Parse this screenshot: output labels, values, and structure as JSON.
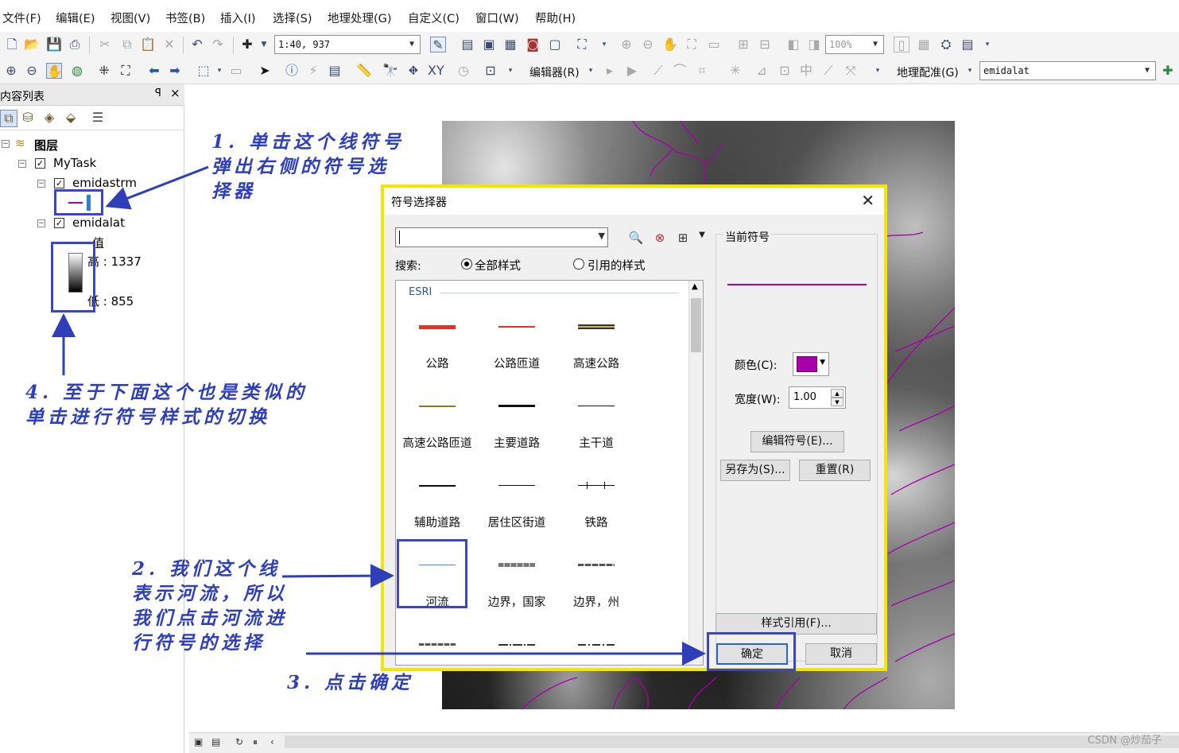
{
  "menu": [
    "文件(F)",
    "编辑(E)",
    "视图(V)",
    "书签(B)",
    "插入(I)",
    "选择(S)",
    "地理处理(G)",
    "自定义(C)",
    "窗口(W)",
    "帮助(H)"
  ],
  "toolbar": {
    "scale": "1:40, 937",
    "zoom_percent": "100%",
    "editor_label": "编辑器(R)",
    "georef_label": "地理配准(G)",
    "georef_layer": "emidalat"
  },
  "toc": {
    "title": "内容列表",
    "pin": "ᵖ",
    "close": "×",
    "root": "图层",
    "frame": "MyTask",
    "layer1": "emidastrm",
    "layer2": "emidalat",
    "legend_header": "值",
    "high": "高 : 1337",
    "low": "低 : 855"
  },
  "dialog": {
    "title": "符号选择器",
    "search_label": "搜索:",
    "radio_all": "全部样式",
    "radio_ref": "引用的样式",
    "group": "ESRI",
    "current_symbol": "当前符号",
    "color_label": "颜色(C):",
    "color_value": "#a800a8",
    "width_label": "宽度(W):",
    "width_value": "1.00",
    "edit_button": "编辑符号(E)...",
    "saveas_button": "另存为(S)...",
    "reset_button": "重置(R)",
    "style_ref_button": "样式引用(F)...",
    "ok_button": "确定",
    "cancel_button": "取消",
    "symbols": [
      "公路",
      "公路匝道",
      "高速公路",
      "高速公路匝道",
      "主要道路",
      "主干道",
      "辅助道路",
      "居住区街道",
      "铁路",
      "河流",
      "边界，国家",
      "边界，州"
    ]
  },
  "annotations": {
    "a1": [
      "1. 单击这个线符号",
      "弹出右侧的符号选",
      "择器"
    ],
    "a2": [
      "2. 我们这个线",
      "表示河流，所以",
      "我们点击河流进",
      "行符号的选择"
    ],
    "a3": "3. 点击确定",
    "a4": [
      "4. 至于下面这个也是类似的",
      "单击进行符号样式的切换"
    ]
  },
  "watermark": "CSDN @炒茄子",
  "colors": {
    "annotation": "#2e3fb9",
    "dialog_border": "#f3e600",
    "river_symbol": "#a800a8"
  }
}
